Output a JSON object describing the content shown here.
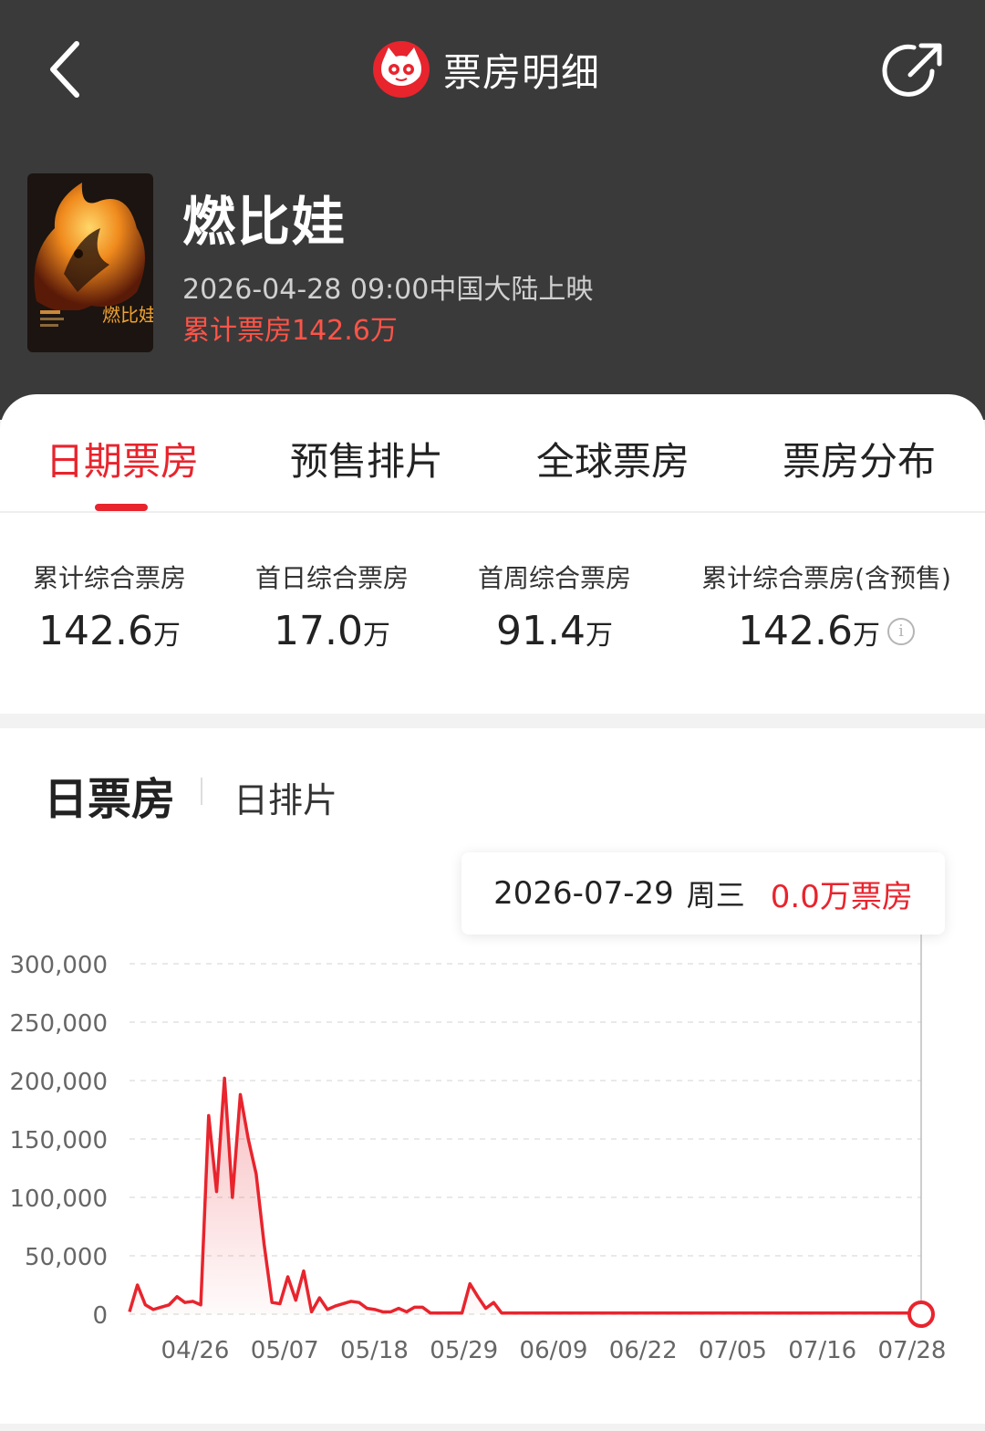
{
  "nav": {
    "title": "票房明细"
  },
  "movie": {
    "name": "燃比娃",
    "release": "2026-04-28 09:00中国大陆上映",
    "cumulative_text": "累计票房142.6万",
    "poster_title": "燃比娃"
  },
  "tabs": [
    {
      "label": "日期票房",
      "active": true
    },
    {
      "label": "预售排片",
      "active": false
    },
    {
      "label": "全球票房",
      "active": false
    },
    {
      "label": "票房分布",
      "active": false
    }
  ],
  "stats": [
    {
      "label": "累计综合票房",
      "value": "142.6",
      "unit": "万"
    },
    {
      "label": "首日综合票房",
      "value": "17.0",
      "unit": "万"
    },
    {
      "label": "首周综合票房",
      "value": "91.4",
      "unit": "万"
    },
    {
      "label": "累计综合票房(含预售)",
      "value": "142.6",
      "unit": "万",
      "info_icon": "info-icon"
    }
  ],
  "chart_tabs": {
    "main": "日票房",
    "sub": "日排片"
  },
  "tooltip": {
    "date": "2026-07-29",
    "weekday": "周三",
    "value": "0.0万票房"
  },
  "colors": {
    "accent": "#e8242d",
    "header_bg": "#3a3a3a",
    "secondary_red": "#ff5448"
  },
  "chart_data": {
    "type": "area",
    "ylim": [
      0,
      300000
    ],
    "y_ticks": [
      "300,000",
      "250,000",
      "200,000",
      "150,000",
      "100,000",
      "50,000",
      "0"
    ],
    "x_tick_labels": [
      "04/26",
      "05/07",
      "05/18",
      "05/29",
      "06/09",
      "06/22",
      "07/05",
      "07/16",
      "07/28"
    ],
    "grid": true,
    "values": [
      2000,
      25000,
      8000,
      4000,
      6000,
      8000,
      15000,
      10000,
      11000,
      8000,
      170000,
      105000,
      202000,
      100000,
      188000,
      150000,
      120000,
      60000,
      10000,
      9000,
      32000,
      12000,
      37000,
      2000,
      14000,
      4000,
      7000,
      9000,
      11000,
      10000,
      5000,
      4000,
      2000,
      2000,
      5000,
      2000,
      6000,
      6000,
      1000,
      1000,
      1000,
      1000,
      1000,
      26000,
      15000,
      5000,
      10000,
      1000,
      1000,
      1000,
      1000,
      1000,
      1000,
      1000,
      1000,
      1000,
      1000,
      1000,
      1000,
      1000,
      1000,
      1000,
      1000,
      1000,
      1000,
      1000,
      1000,
      1000,
      1000,
      1000,
      1000,
      1000,
      1000,
      1000,
      1000,
      1000,
      1000,
      1000,
      1000,
      1000,
      1000,
      1000,
      1000,
      1000,
      1000,
      1000,
      1000,
      1000,
      1000,
      1000,
      1000,
      1000,
      1000,
      1000,
      1000,
      1000,
      1000,
      1000,
      1000,
      1000,
      0
    ],
    "highlight_last": true
  }
}
